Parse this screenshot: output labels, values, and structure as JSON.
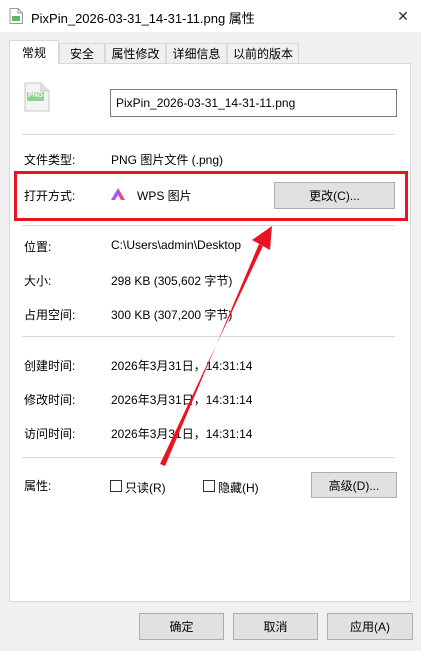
{
  "window": {
    "title": "PixPin_2026-03-31_14-31-11.png 属性",
    "close_glyph": "✕"
  },
  "tabs": [
    {
      "label": "常规",
      "active": true
    },
    {
      "label": "安全"
    },
    {
      "label": "属性修改"
    },
    {
      "label": "详细信息"
    },
    {
      "label": "以前的版本"
    }
  ],
  "general": {
    "file_icon_text": "PNG",
    "filename": "PixPin_2026-03-31_14-31-11.png",
    "file_type_label": "文件类型:",
    "file_type_value": "PNG 图片文件 (.png)",
    "open_with_label": "打开方式:",
    "open_with_app": "WPS 图片",
    "change_button": "更改(C)...",
    "location_label": "位置:",
    "location_value": "C:\\Users\\admin\\Desktop",
    "size_label": "大小:",
    "size_value": "298 KB (305,602 字节)",
    "size_on_disk_label": "占用空间:",
    "size_on_disk_value": "300 KB (307,200 字节)",
    "created_label": "创建时间:",
    "created_value": "2026年3月31日，14:31:14",
    "modified_label": "修改时间:",
    "modified_value": "2026年3月31日，14:31:14",
    "accessed_label": "访问时间:",
    "accessed_value": "2026年3月31日，14:31:14",
    "attributes_label": "属性:",
    "readonly_label": "只读(R)",
    "hidden_label": "隐藏(H)",
    "advanced_button": "高级(D)..."
  },
  "footer": {
    "ok": "确定",
    "cancel": "取消",
    "apply": "应用(A)"
  },
  "colors": {
    "highlight": "#e8141f",
    "wps_icon": "#8a4dff"
  }
}
